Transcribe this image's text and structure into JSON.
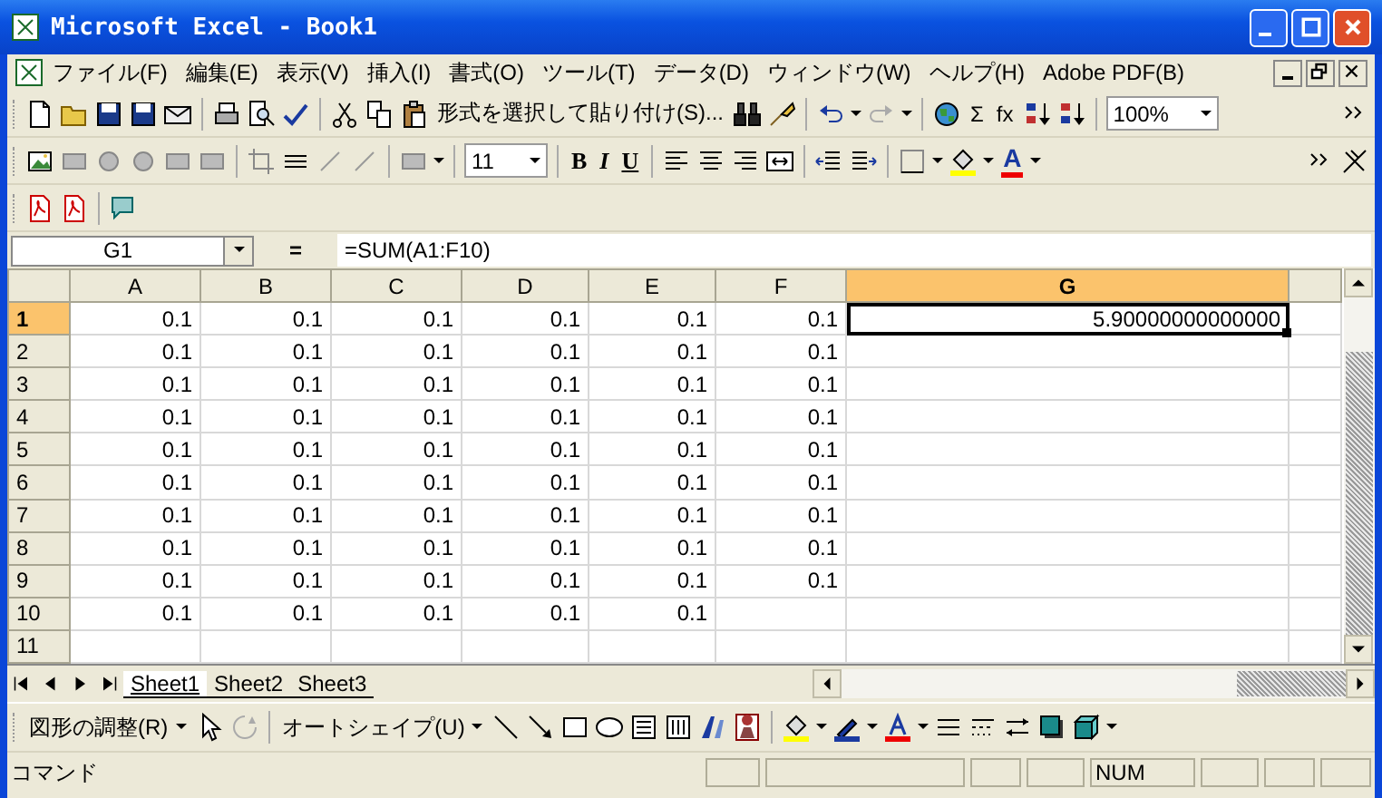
{
  "window": {
    "title": "Microsoft Excel - Book1"
  },
  "menu": [
    "ファイル(F)",
    "編集(E)",
    "表示(V)",
    "挿入(I)",
    "書式(O)",
    "ツール(T)",
    "データ(D)",
    "ウィンドウ(W)",
    "ヘルプ(H)",
    "Adobe PDF(B)"
  ],
  "toolbars": [
    {
      "items": [
        {
          "kind": "button",
          "label": "形式を選択して貼り付け(S)..."
        },
        {
          "kind": "button",
          "label": "Σ"
        },
        {
          "kind": "button",
          "label": "fx"
        },
        {
          "kind": "combo",
          "value": "100%"
        }
      ]
    },
    {
      "items": [
        {
          "kind": "combo",
          "value": "11"
        },
        {
          "kind": "button",
          "label": "B"
        },
        {
          "kind": "button",
          "label": "I"
        },
        {
          "kind": "button",
          "label": "U"
        },
        {
          "kind": "font-color",
          "label": "A"
        }
      ]
    }
  ],
  "formula_bar": {
    "name_box": "G1",
    "equals": "=",
    "formula": "=SUM(A1:F10)"
  },
  "sheet": {
    "columns": [
      {
        "label": "A",
        "selected": false
      },
      {
        "label": "B",
        "selected": false
      },
      {
        "label": "C",
        "selected": false
      },
      {
        "label": "D",
        "selected": false
      },
      {
        "label": "E",
        "selected": false
      },
      {
        "label": "F",
        "selected": false
      },
      {
        "label": "G",
        "selected": true
      }
    ],
    "rows": [
      {
        "label": "1",
        "selected": true,
        "cells": [
          "0.1",
          "0.1",
          "0.1",
          "0.1",
          "0.1",
          "0.1",
          "5.90000000000000"
        ]
      },
      {
        "label": "2",
        "selected": false,
        "cells": [
          "0.1",
          "0.1",
          "0.1",
          "0.1",
          "0.1",
          "0.1"
        ]
      },
      {
        "label": "3",
        "selected": false,
        "cells": [
          "0.1",
          "0.1",
          "0.1",
          "0.1",
          "0.1",
          "0.1"
        ]
      },
      {
        "label": "4",
        "selected": false,
        "cells": [
          "0.1",
          "0.1",
          "0.1",
          "0.1",
          "0.1",
          "0.1"
        ]
      },
      {
        "label": "5",
        "selected": false,
        "cells": [
          "0.1",
          "0.1",
          "0.1",
          "0.1",
          "0.1",
          "0.1"
        ]
      },
      {
        "label": "6",
        "selected": false,
        "cells": [
          "0.1",
          "0.1",
          "0.1",
          "0.1",
          "0.1",
          "0.1"
        ]
      },
      {
        "label": "7",
        "selected": false,
        "cells": [
          "0.1",
          "0.1",
          "0.1",
          "0.1",
          "0.1",
          "0.1"
        ]
      },
      {
        "label": "8",
        "selected": false,
        "cells": [
          "0.1",
          "0.1",
          "0.1",
          "0.1",
          "0.1",
          "0.1"
        ]
      },
      {
        "label": "9",
        "selected": false,
        "cells": [
          "0.1",
          "0.1",
          "0.1",
          "0.1",
          "0.1",
          "0.1"
        ]
      },
      {
        "label": "10",
        "selected": false,
        "cells": [
          "0.1",
          "0.1",
          "0.1",
          "0.1",
          "0.1"
        ]
      },
      {
        "label": "11",
        "selected": false
      }
    ],
    "selected_cell": [
      {
        "selected": false
      },
      {
        "selected": false
      },
      {
        "selected": false
      },
      {
        "selected": false
      },
      {
        "selected": false
      },
      {
        "selected": false
      },
      {
        "selected": true
      }
    ]
  },
  "sheet_tabs": [
    {
      "label": "Sheet1",
      "selected": true
    },
    {
      "label": "Sheet2",
      "selected": false
    },
    {
      "label": "Sheet3",
      "selected": false
    }
  ],
  "drawing_toolbar": {
    "items": [
      "図形の調整(R)",
      "オートシェイプ(U)"
    ]
  },
  "status_bar": {
    "message": "コマンド",
    "indicators": [
      "NUM"
    ]
  }
}
